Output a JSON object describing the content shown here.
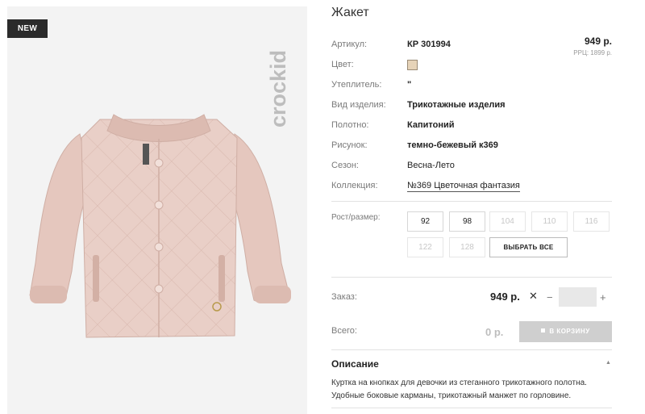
{
  "product": {
    "badge": "NEW",
    "brand": "crockid",
    "title": "Жакет",
    "price": "949 р.",
    "rrp": "РРЦ: 1899 р.",
    "swatch_color": "#e6d3b8"
  },
  "specs": [
    {
      "label": "Артикул:",
      "value": "КР 301994"
    },
    {
      "label": "Цвет:",
      "value": ""
    },
    {
      "label": "Утеплитель:",
      "value": "\""
    },
    {
      "label": "Вид изделия:",
      "value": "Трикотажные изделия"
    },
    {
      "label": "Полотно:",
      "value": "Капитоний"
    },
    {
      "label": "Рисунок:",
      "value": "темно-бежевый к369"
    },
    {
      "label": "Сезон:",
      "value": "Весна-Лето"
    },
    {
      "label": "Коллекция:",
      "value": "№369 Цветочная фантазия"
    }
  ],
  "sizes": {
    "label": "Рост/размер:",
    "options": [
      {
        "value": "92",
        "available": true
      },
      {
        "value": "98",
        "available": true
      },
      {
        "value": "104",
        "available": false
      },
      {
        "value": "110",
        "available": false
      },
      {
        "value": "116",
        "available": false
      },
      {
        "value": "122",
        "available": false
      },
      {
        "value": "128",
        "available": false
      }
    ],
    "select_all": "ВЫБРАТЬ ВСЕ"
  },
  "order": {
    "label": "Заказ:",
    "price": "949 р.",
    "times": "✕",
    "minus": "−",
    "plus": "+",
    "quantity": ""
  },
  "total": {
    "label": "Всего:",
    "value": "0 р.",
    "cart_button": "В КОРЗИНУ"
  },
  "description": {
    "heading": "Описание",
    "text": "Куртка на кнопках для девочки из стеганного трикотажного полотна. Удобные боковые карманы, трикотажный манжет по горловине."
  },
  "colors": {
    "badge_bg": "#2b2b2b",
    "jacket": "#e9cfc7",
    "cart_disabled": "#cfcfcf"
  }
}
